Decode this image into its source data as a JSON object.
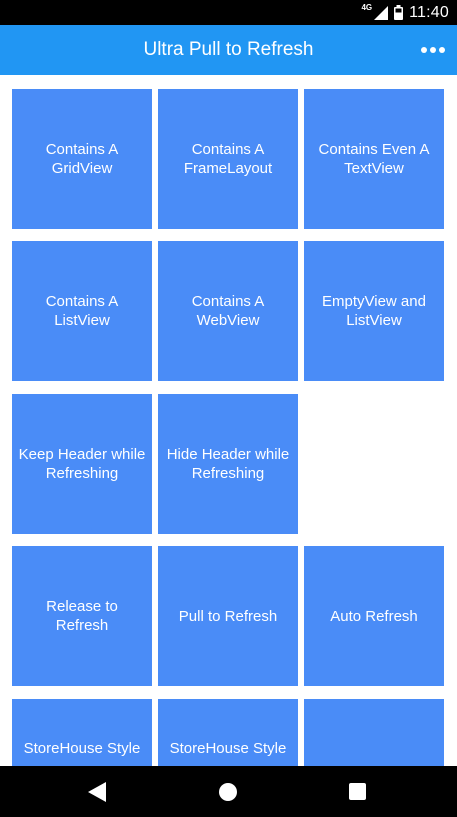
{
  "status": {
    "network": "4G",
    "time": "11:40"
  },
  "app_bar": {
    "title": "Ultra Pull to Refresh",
    "overflow_icon": "more-horizontal-icon"
  },
  "tiles": [
    "Contains A GridView",
    "Contains A FrameLayout",
    "Contains Even A TextView",
    "Contains A ListView",
    "Contains A WebView",
    "EmptyView and ListView",
    "Keep Header while Refreshing",
    "Hide Header while Refreshing",
    "Release to Refresh",
    "Pull to Refresh",
    "Auto Refresh",
    "StoreHouse Style",
    "StoreHouse Style"
  ],
  "nav": {
    "back_icon": "back-triangle-icon",
    "home_icon": "home-circle-icon",
    "recents_icon": "recents-square-icon"
  },
  "colors": {
    "app_bar": "#2196F3",
    "tile": "#4A8CF7",
    "status_bar": "#000000",
    "nav_bar": "#000000"
  }
}
